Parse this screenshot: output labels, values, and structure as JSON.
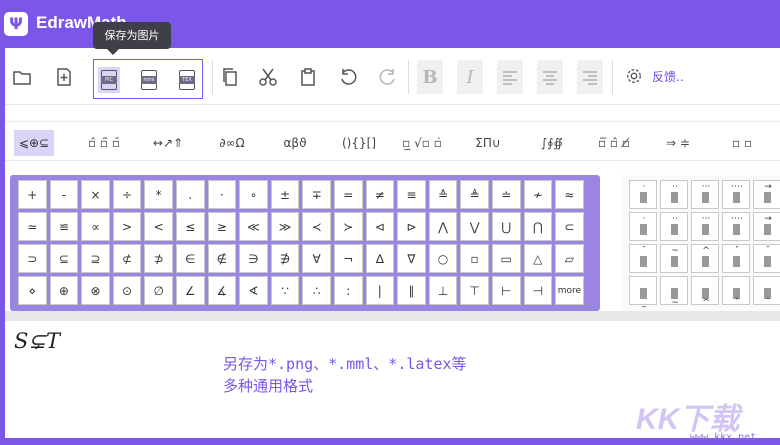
{
  "app": {
    "logo": "Ψ",
    "title": "EdrawMath"
  },
  "tooltip": "保存为图片",
  "toolbar": {
    "save_formats": [
      "PIC",
      "mml",
      "TEX"
    ],
    "feedback": "反馈.."
  },
  "categories": [
    "⩽⊕⊆",
    "▫̂ ▫̃ ▫̄",
    "↔↗⇑",
    "∂∞Ω",
    "αβϑ",
    "(){}[]",
    "▫̲ √▫ ▫̇",
    "ΣΠ∪",
    "∫∮∯",
    "▫̅ ▫̂ ▫̸",
    "⇒ ≑",
    "▫ ▫"
  ],
  "symbol_grid": [
    [
      "+",
      "-",
      "×",
      "÷",
      "*",
      ".",
      "·",
      "∘",
      "±",
      "∓",
      "=",
      "≠",
      "≡",
      "≙",
      "≜",
      "≐",
      "≁",
      "≈"
    ],
    [
      "≃",
      "≌",
      "∝",
      ">",
      "<",
      "≤",
      "≥",
      "≪",
      "≫",
      "≺",
      "≻",
      "⊲",
      "⊳",
      "⋀",
      "⋁",
      "⋃",
      "⋂",
      "⊂"
    ],
    [
      "⊃",
      "⊆",
      "⊇",
      "⊄",
      "⊅",
      "∈",
      "∉",
      "∋",
      "∌",
      "∀",
      "¬",
      "∆",
      "∇",
      "○",
      "▫",
      "▭",
      "△",
      "▱"
    ],
    [
      "⋄",
      "⊕",
      "⊗",
      "⊙",
      "∅",
      "∠",
      "∡",
      "∢",
      "∵",
      "∴",
      ":",
      "|",
      "∥",
      "⊥",
      "⊤",
      "⊢",
      "⊣",
      "more"
    ]
  ],
  "accent_grid": [
    [
      "·",
      "··",
      "···",
      "····",
      "→"
    ],
    [
      "·",
      "··",
      "···",
      "····",
      "→"
    ],
    [
      "¯",
      "~",
      "^",
      "ˇ",
      "˘"
    ],
    [
      "_",
      "~",
      "^",
      "ˇ",
      "˘"
    ]
  ],
  "editor": {
    "formula": "S⊊T",
    "annotation_line1": "另存为*.png、*.mml、*.latex等",
    "annotation_line2": "多种通用格式"
  },
  "watermark": {
    "text": "KK下载",
    "url": "www.kkx.net"
  }
}
